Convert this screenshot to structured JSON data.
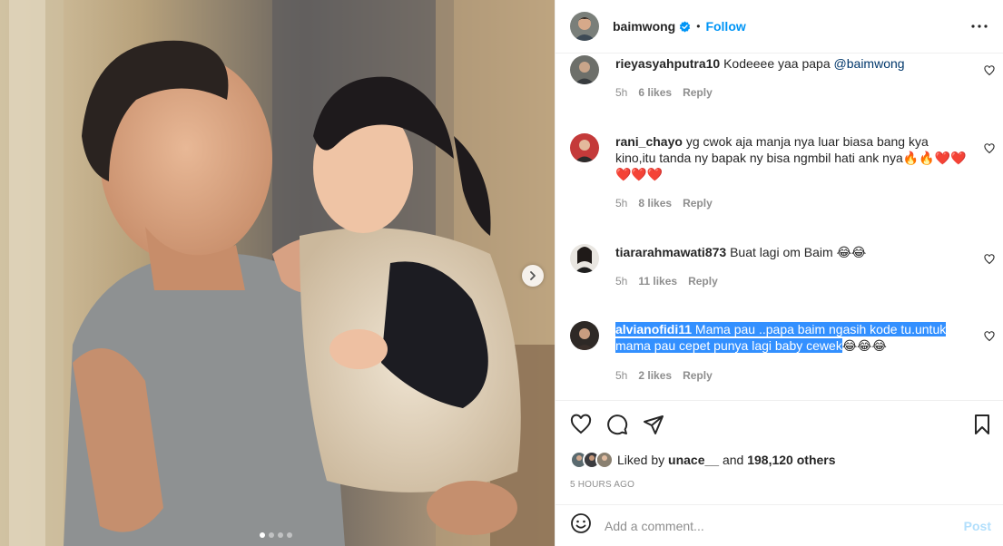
{
  "post": {
    "username": "baimwong",
    "verified": true,
    "separator": "•",
    "follow_label": "Follow",
    "carousel": {
      "count": 4,
      "active_index": 0
    }
  },
  "comments": [
    {
      "username": "rieyasyahputra10",
      "text": "Kodeeee yaa papa ",
      "mention": "@baimwong",
      "time": "5h",
      "likes": "6 likes",
      "reply": "Reply"
    },
    {
      "username": "rani_chayo",
      "text": "yg cwok aja manja nya luar biasa bang kya kino,itu tanda ny bapak ny bisa ngmbil hati ank nya🔥🔥❤️❤️❤️❤️❤️",
      "time": "5h",
      "likes": "8 likes",
      "reply": "Reply"
    },
    {
      "username": "tiararahmawati873",
      "text": "Buat lagi om Baim 😂😂",
      "time": "5h",
      "likes": "11 likes",
      "reply": "Reply"
    },
    {
      "username": "alvianofidi11",
      "text": " Mama pau ..papa baim ngasih kode tu.untuk mama pau cepet punya lagi baby cewek",
      "emoji": "😂😂😂",
      "time": "5h",
      "likes": "2 likes",
      "reply": "Reply"
    }
  ],
  "likes": {
    "prefix": "Liked by ",
    "user": "unace__",
    "middle": " and ",
    "count": "198,120 others"
  },
  "time_ago": "5 HOURS AGO",
  "composer": {
    "placeholder": "Add a comment...",
    "post_label": "Post"
  },
  "colors": {
    "accent": "#0095f6",
    "post_disabled": "#b2dffc",
    "selection": "#3390ff"
  }
}
